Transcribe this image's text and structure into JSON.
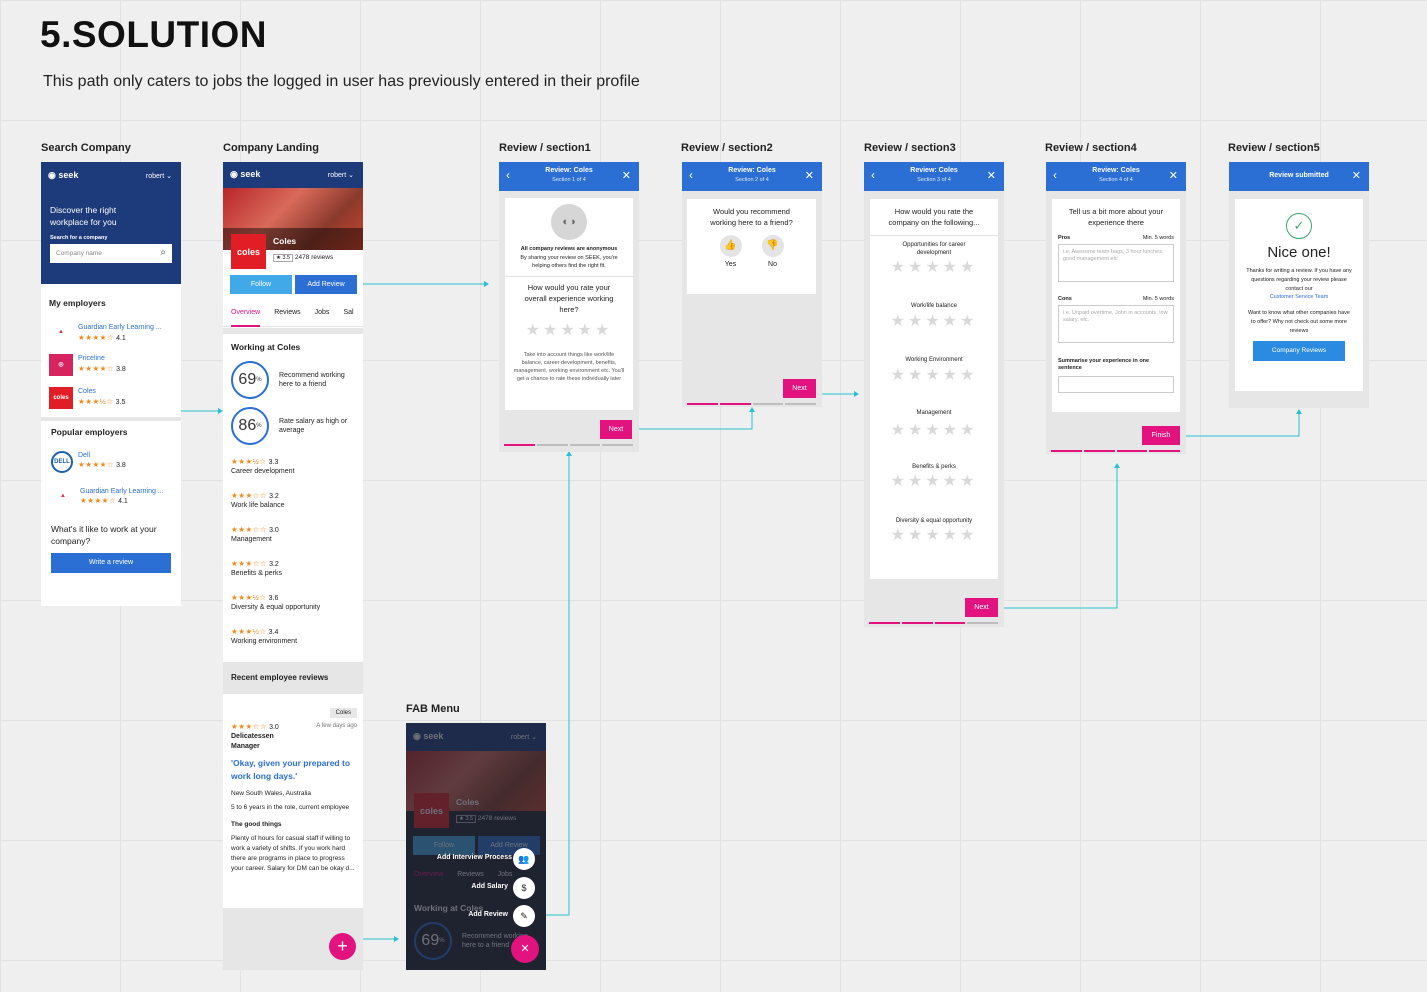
{
  "page": {
    "title": "5.SOLUTION",
    "subtitle": "This path only caters to jobs the logged in user has previously entered in their profile"
  },
  "frames": {
    "search": "Search Company",
    "landing": "Company Landing",
    "s1": "Review / section1",
    "s2": "Review / section2",
    "s3": "Review / section3",
    "s4": "Review / section4",
    "s5": "Review / section5",
    "fab": "FAB Menu"
  },
  "brand": {
    "logo": "seek",
    "user": "robert"
  },
  "search": {
    "hero": "Discover the right workplace for you",
    "label": "Search for a company",
    "placeholder": "Company name",
    "my_employers": "My employers",
    "popular": "Popular employers",
    "mine": [
      {
        "name": "Guardian Early Learning ...",
        "rating": "4.1",
        "stars": "★★★★☆"
      },
      {
        "name": "Priceline",
        "rating": "3.8",
        "stars": "★★★★☆"
      },
      {
        "name": "Coles",
        "rating": "3.5",
        "stars": "★★★½☆"
      }
    ],
    "pop": [
      {
        "name": "Dell",
        "rating": "3.8",
        "stars": "★★★★☆"
      },
      {
        "name": "Guardian Early Learning ...",
        "rating": "4.1",
        "stars": "★★★★☆"
      }
    ],
    "question": "What's it like to work at your company?",
    "write": "Write a review"
  },
  "landing": {
    "company": "Coles",
    "rating_badge": "★ 3.5",
    "reviews": "2478 reviews",
    "follow": "Follow",
    "add_review": "Add Review",
    "tabs": [
      "Overview",
      "Reviews",
      "Jobs",
      "Sal"
    ],
    "working": "Working at Coles",
    "recommend_pct": "69",
    "recommend_text": "Recommend working here to a friend",
    "salary_pct": "86",
    "salary_text": "Rate salary as high or average",
    "ratings": [
      {
        "v": "3.3",
        "l": "Career development",
        "s": "★★★½☆"
      },
      {
        "v": "3.2",
        "l": "Work life balance",
        "s": "★★★☆☆"
      },
      {
        "v": "3.0",
        "l": "Management",
        "s": "★★★☆☆"
      },
      {
        "v": "3.2",
        "l": "Benefits & perks",
        "s": "★★★☆☆"
      },
      {
        "v": "3.6",
        "l": "Diversity & equal opportunity",
        "s": "★★★½☆"
      },
      {
        "v": "3.4",
        "l": "Working environment",
        "s": "★★★½☆"
      }
    ],
    "recent": "Recent employee reviews",
    "tag": "Coles",
    "r_rating": "3.0",
    "r_stars": "★★★☆☆",
    "r_date": "A few days ago",
    "r_role": "Delicatessen Manager",
    "r_quote": "'Okay, given your prepared to work long days.'",
    "r_loc": "New South Wales, Australia",
    "r_tenure": "5 to 6 years in the role, current employee",
    "r_good": "The good things",
    "r_body": "Plenty of hours for casual staff if willing to work a variety of shifts. If you work hard there are programs in place to progress your career. Salary for DM can be okay d..."
  },
  "s1": {
    "head": "Review: Coles",
    "sec": "Section 1 of 4",
    "anon": "All company reviews are anonymous",
    "anon_sub": "By sharing your review on SEEK, you're helping others find the right fit.",
    "q": "How would you rate your overall experience working here?",
    "hint": "Take into account things like work/life balance, career development, benefits, management, working environment etc. You'll get a chance to rate these individually later",
    "next": "Next"
  },
  "s2": {
    "head": "Review: Coles",
    "sec": "Section 2 of 4",
    "q": "Would you recommend working here to a friend?",
    "yes": "Yes",
    "no": "No",
    "next": "Next"
  },
  "s3": {
    "head": "Review: Coles",
    "sec": "Section 3 of 4",
    "q": "How would you rate the company on the following...",
    "items": [
      "Opportunities for career development",
      "Work/life balance",
      "Working Environment",
      "Management",
      "Benefits & perks",
      "Diversity & equal opportunity"
    ],
    "next": "Next"
  },
  "s4": {
    "head": "Review: Coles",
    "sec": "Section 4 of 4",
    "q": "Tell us a bit more about your experience there",
    "pros": "Pros",
    "pros_min": "Min. 5 words",
    "pros_ph": "i.e. Awesome team bags, 3 hour lunches, good management etc",
    "cons": "Cons",
    "cons_min": "Min. 5 words",
    "cons_ph": "i.e. Unpaid overtime, John in accounts, low salary, etc.",
    "summ": "Summarise your experience in one sentence",
    "finish": "Finish"
  },
  "s5": {
    "head": "Review submitted",
    "nice": "Nice one!",
    "thanks": "Thanks for writing a review. If you have any questions regarding your review please contact our",
    "team": "Customer Service Team",
    "want": "Want to know what other companies have to offer? Why not check out some more reviews",
    "btn": "Company Reviews"
  },
  "fab": {
    "interview": "Add Interview Process",
    "salary": "Add Salary",
    "review": "Add Review",
    "close": "✕",
    "plus": "+"
  }
}
